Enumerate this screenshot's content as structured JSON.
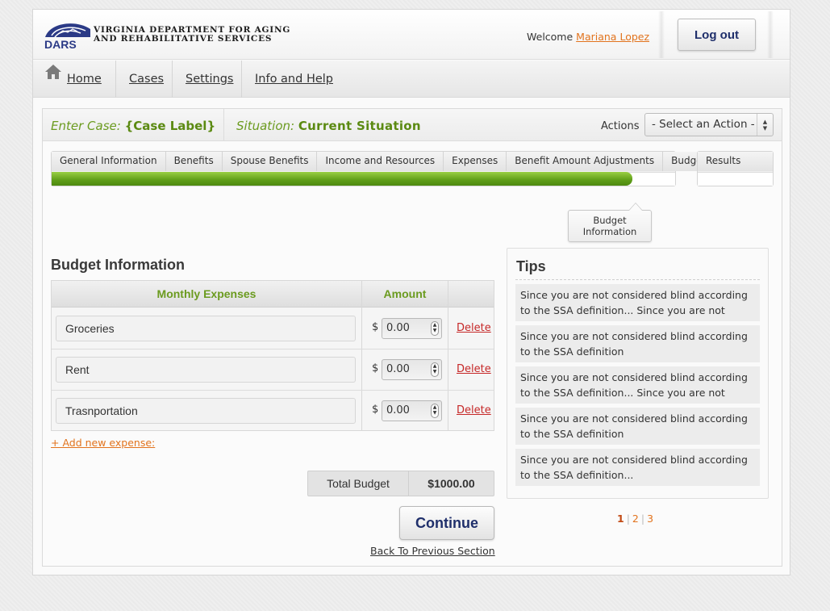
{
  "header": {
    "org_line1": "Virginia Department for Aging",
    "org_line2": "and Rehabilitative Services",
    "logo_abbr": "DARS",
    "welcome_label": "Welcome",
    "user_name": "Mariana Lopez",
    "logout_label": "Log out"
  },
  "nav": {
    "home": "Home",
    "cases": "Cases",
    "settings": "Settings",
    "info": "Info and Help"
  },
  "case_bar": {
    "enter_case_label": "Enter Case:",
    "case_value": "{Case Label}",
    "situation_label": "Situation:",
    "situation_value": "Current Situation",
    "actions_label": "Actions",
    "action_select_value": "- Select an Action -"
  },
  "steps": {
    "items": [
      "General Information",
      "Benefits",
      "Spouse Benefits",
      "Income and Resources",
      "Expenses",
      "Benefit Amount Adjustments",
      "Budget"
    ],
    "progress_fraction": 0.932,
    "results_label": "Results",
    "tooltip": "Budget Information"
  },
  "budget": {
    "title": "Budget Information",
    "col_expenses": "Monthly Expenses",
    "col_amount": "Amount",
    "currency": "$",
    "rows": [
      {
        "name": "Groceries",
        "amount": "0.00",
        "delete": "Delete"
      },
      {
        "name": "Rent",
        "amount": "0.00",
        "delete": "Delete"
      },
      {
        "name": "Trasnportation",
        "amount": "0.00",
        "delete": "Delete"
      }
    ],
    "add_expense": "+ Add new expense:",
    "total_label": "Total Budget",
    "total_value": "$1000.00",
    "continue_label": "Continue",
    "back_label": "Back To Previous Section"
  },
  "tips": {
    "title": "Tips",
    "items": [
      "Since you are not considered blind according to the SSA definition... Since you are not",
      "Since you are not considered blind according to the SSA definition",
      "Since you are not considered blind according to the SSA definition... Since you are not",
      "Since you are not considered blind according to the SSA definition",
      "Since you are not considered blind according to the SSA definition..."
    ],
    "pages": [
      "1",
      "2",
      "3"
    ],
    "current_page": "1"
  },
  "colors": {
    "accent_green": "#6b9b1f",
    "link_orange": "#e2731d",
    "delete_red": "#c62828",
    "button_text_navy": "#1f2f6b"
  }
}
